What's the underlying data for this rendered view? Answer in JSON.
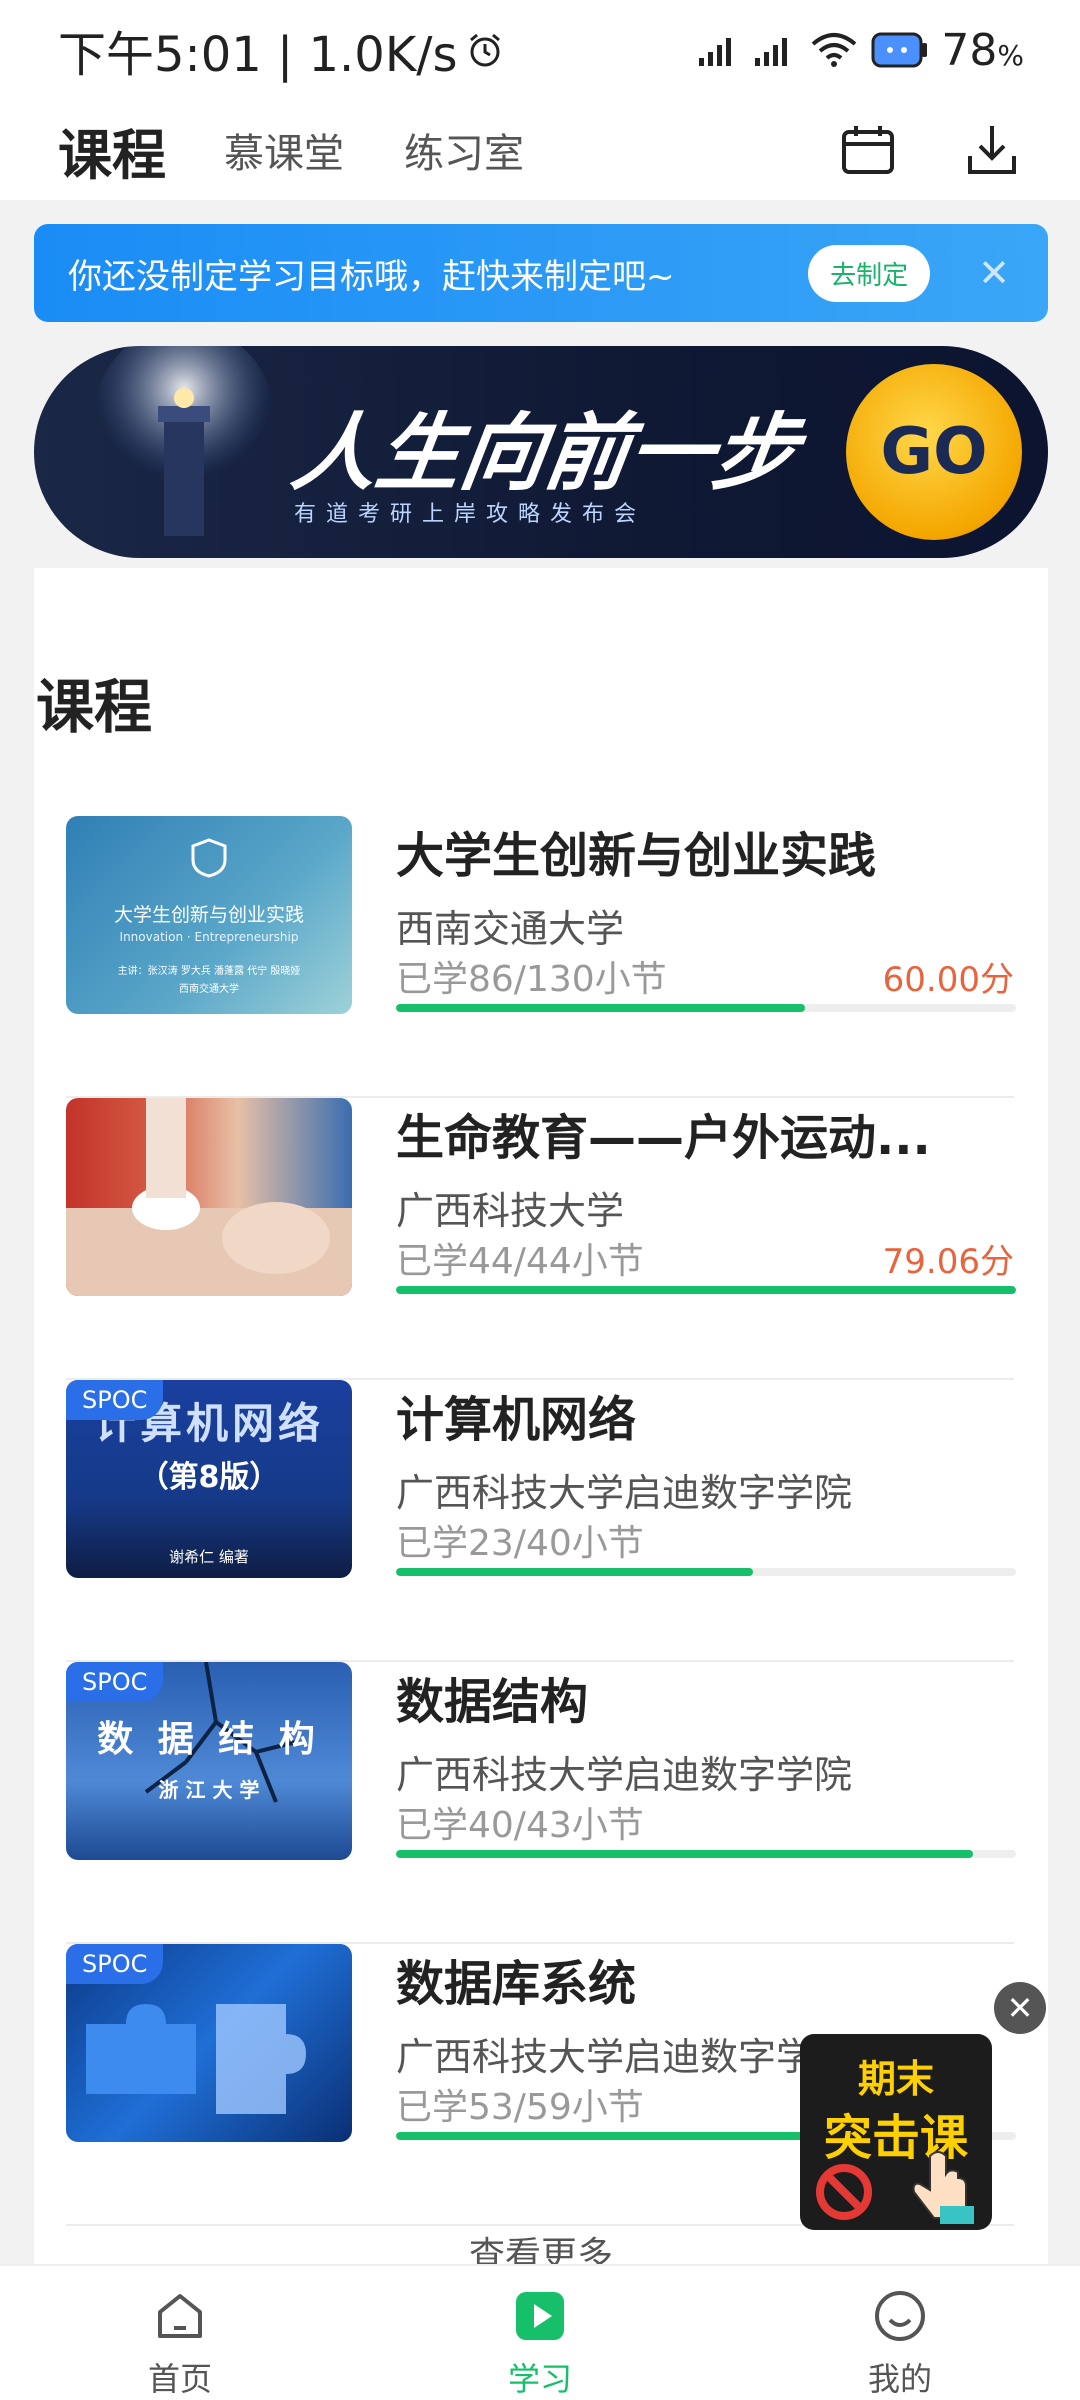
{
  "status_bar": {
    "time": "下午5:01 | 1.0K/s",
    "battery": "78",
    "battery_unit": "%"
  },
  "top_nav": {
    "tabs": [
      {
        "label": "课程",
        "active": true
      },
      {
        "label": "慕课堂",
        "active": false
      },
      {
        "label": "练习室",
        "active": false
      }
    ],
    "icons": [
      "calendar-icon",
      "download-icon"
    ]
  },
  "goal_banner": {
    "text": "你还没制定学习目标哦，赶快来制定吧~",
    "button": "去制定",
    "close": "✕"
  },
  "promo": {
    "headline": "人生向前一步",
    "subtitle": "有道考研上岸攻略发布会",
    "go": "GO"
  },
  "courses_section": {
    "title": "课程",
    "items": [
      {
        "title": "大学生创新与创业实践",
        "school": "西南交通大学",
        "progress": "已学86/130小节",
        "score": "60.00分",
        "progress_fraction": 0.66,
        "spoc": false,
        "thumb": {
          "line1": "大学生创新与创业实践",
          "line2": "Innovation · Entrepreneurship",
          "line3": "主讲：张汉涛 罗大兵 潘蓬露 代宁 殷晓娅",
          "line4": "西南交通大学"
        }
      },
      {
        "title": "生命教育——户外运动...",
        "school": "广西科技大学",
        "progress": "已学44/44小节",
        "score": "79.06分",
        "progress_fraction": 1.0,
        "spoc": false
      },
      {
        "title": "计算机网络",
        "school": "广西科技大学启迪数字学院",
        "progress": "已学23/40小节",
        "score": "",
        "progress_fraction": 0.575,
        "spoc": true,
        "spoc_label": "SPOC",
        "thumb": {
          "line1": "计算机网络",
          "line2": "（第8版）",
          "line3": "谢希仁 编著"
        }
      },
      {
        "title": "数据结构",
        "school": "广西科技大学启迪数字学院",
        "progress": "已学40/43小节",
        "score": "",
        "progress_fraction": 0.93,
        "spoc": true,
        "spoc_label": "SPOC",
        "thumb": {
          "line1": "数 据 结 构",
          "line2": "浙 江 大 学"
        }
      },
      {
        "title": "数据库系统",
        "school": "广西科技大学启迪数字学院",
        "progress": "已学53/59小节",
        "score": "",
        "progress_fraction": 0.9,
        "spoc": true,
        "spoc_label": "SPOC"
      }
    ],
    "see_more": "查看更多"
  },
  "float_ad": {
    "line1": "期末",
    "line2": "突击课",
    "close": "✕"
  },
  "tab_bar": [
    {
      "label": "首页",
      "icon": "home-icon",
      "active": false
    },
    {
      "label": "学习",
      "icon": "play-icon",
      "active": true
    },
    {
      "label": "我的",
      "icon": "smile-icon",
      "active": false
    }
  ],
  "colors": {
    "accent_green": "#16c06a",
    "banner_blue": "#1a8cf5",
    "score_orange": "#e8643c"
  }
}
